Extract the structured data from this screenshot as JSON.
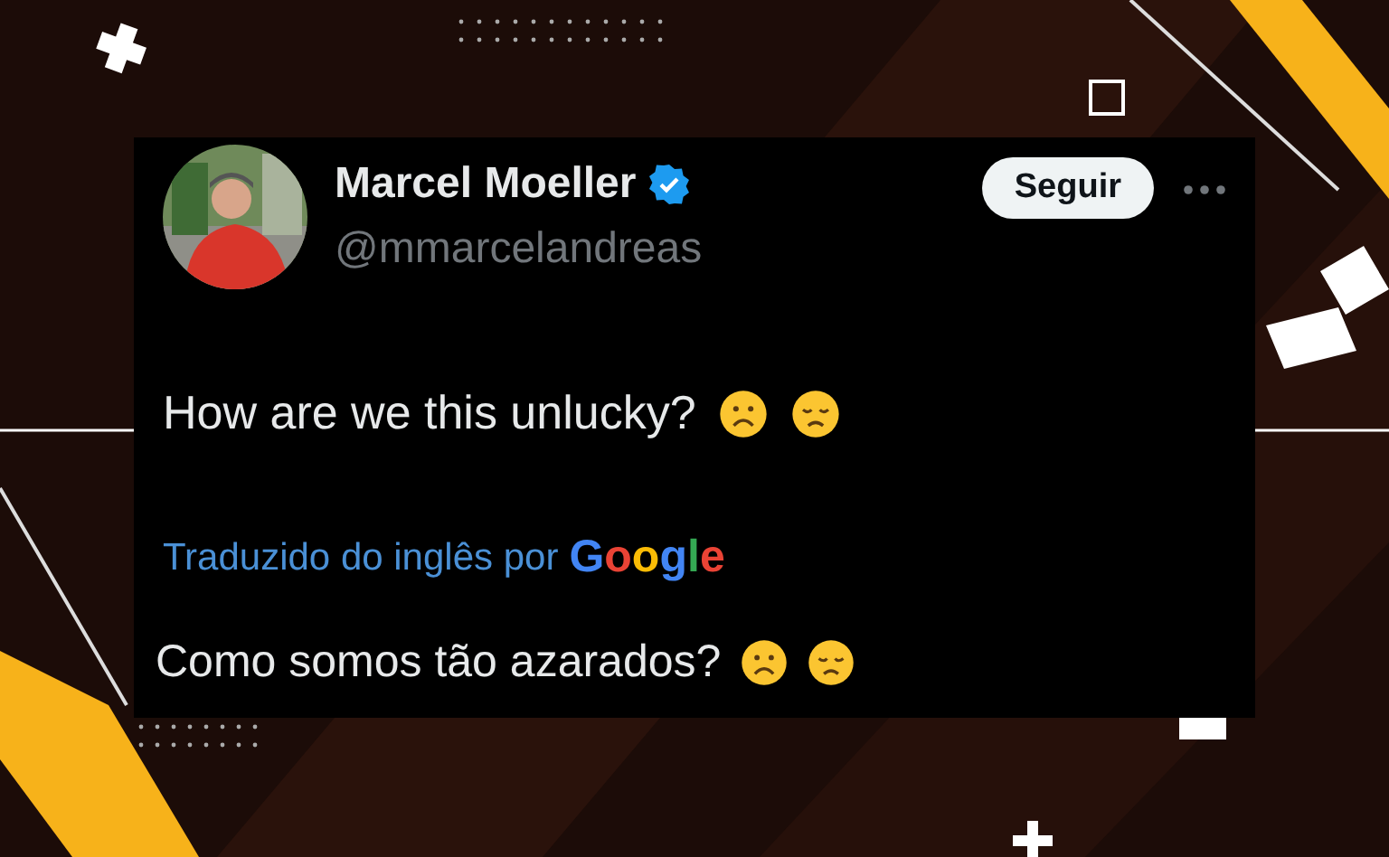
{
  "tweet": {
    "author": {
      "name": "Marcel Moeller",
      "verified": true,
      "handle": "@mmarcelandreas"
    },
    "follow_button": "Seguir",
    "text": "How are we this unlucky?",
    "translation": {
      "label": "Traduzido do inglês por",
      "provider": "Google"
    },
    "translated_text": "Como somos tão azarados?"
  }
}
